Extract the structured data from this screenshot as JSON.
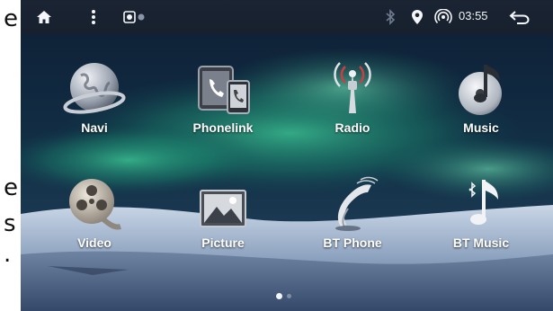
{
  "side_text": {
    "c1": "e",
    "c2": "e",
    "c3": "s",
    "c4": "."
  },
  "status_bar": {
    "icons": [
      "home-icon",
      "more-vert-icon",
      "record-icon",
      "bluetooth-icon",
      "location-icon",
      "hotspot-icon",
      "back-icon"
    ],
    "time": "03:55"
  },
  "apps": [
    {
      "label": "Navi",
      "icon": "globe-icon"
    },
    {
      "label": "Phonelink",
      "icon": "phonelink-icon"
    },
    {
      "label": "Radio",
      "icon": "radio-tower-icon"
    },
    {
      "label": "Music",
      "icon": "music-disc-icon"
    },
    {
      "label": "Video",
      "icon": "film-reel-icon"
    },
    {
      "label": "Picture",
      "icon": "picture-icon"
    },
    {
      "label": "BT Phone",
      "icon": "bt-phone-icon"
    },
    {
      "label": "BT Music",
      "icon": "bt-music-icon"
    }
  ],
  "pager": {
    "page": 1,
    "pages": 2
  },
  "colors": {
    "status_bar": "#1b2433",
    "aurora": "#2fae84",
    "label": "#ffffff"
  }
}
